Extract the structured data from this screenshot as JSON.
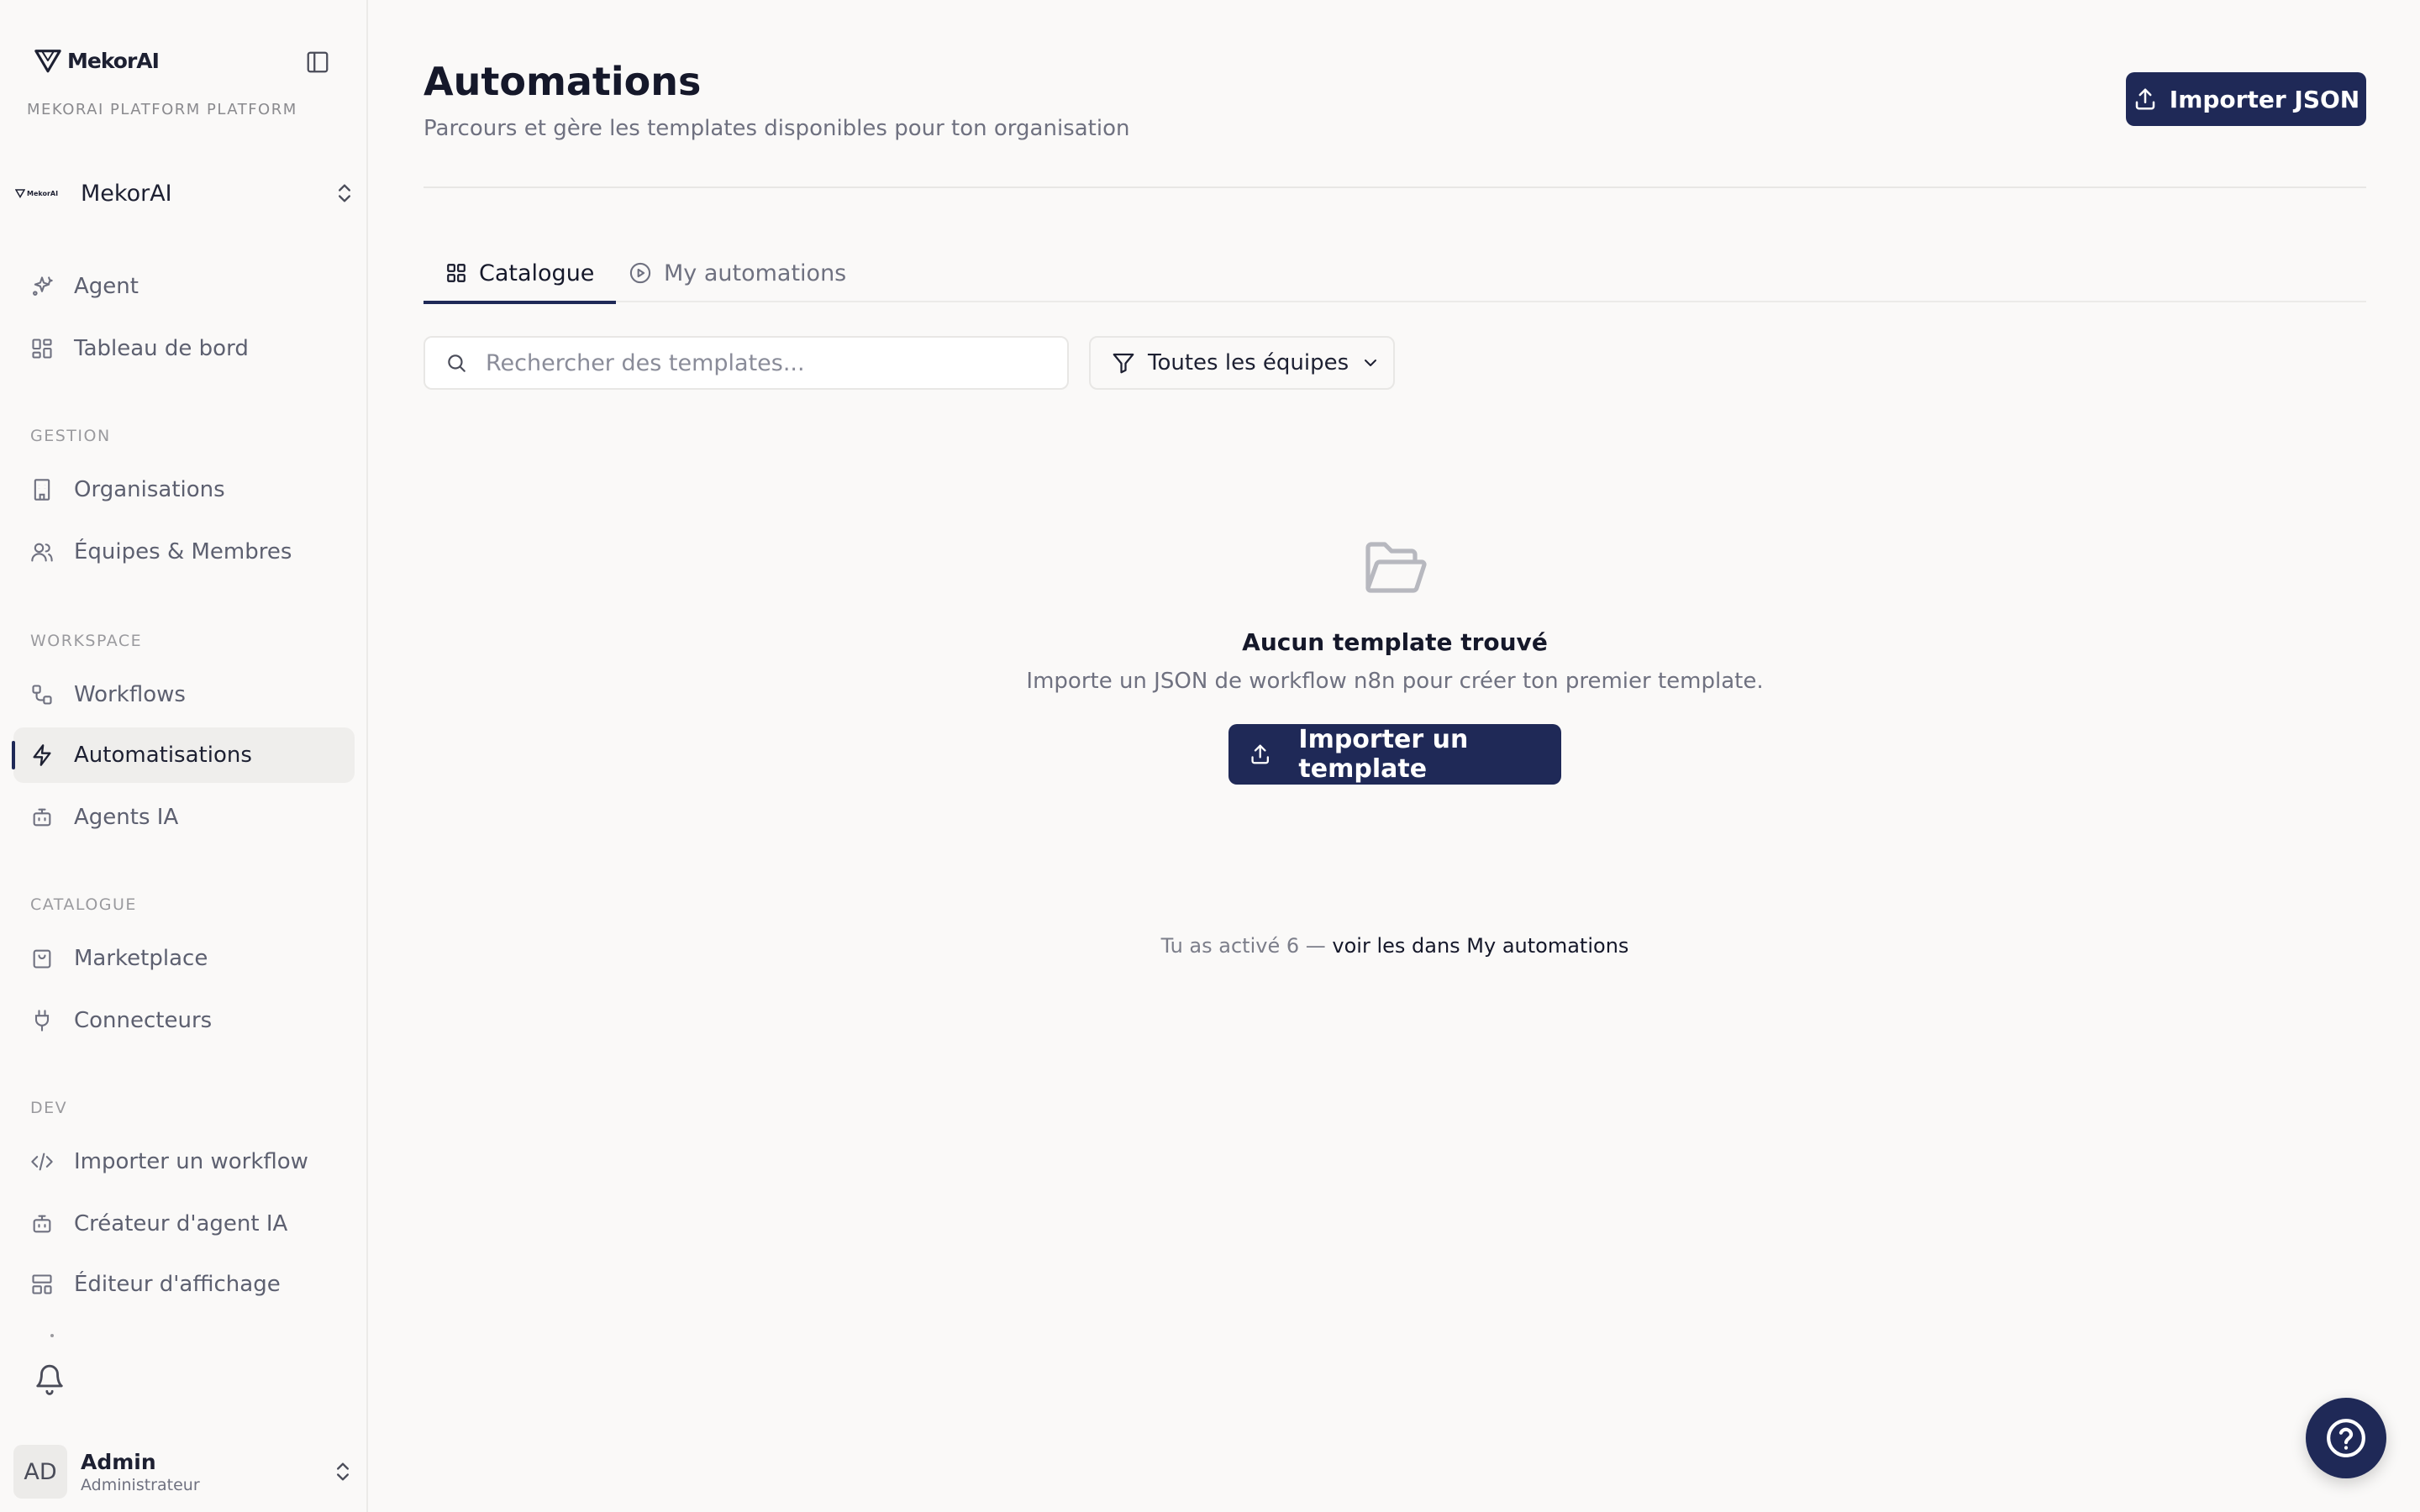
{
  "app": {
    "brand_name": "MekorAI",
    "platform_label": "MEKORAI PLATFORM PLATFORM"
  },
  "org": {
    "logo_text": "MekorAI",
    "name": "MekorAI"
  },
  "sidebar": {
    "top_items": [
      {
        "label": "Agent",
        "icon": "sparkles-icon"
      },
      {
        "label": "Tableau de bord",
        "icon": "dashboard-grid-icon"
      }
    ],
    "sections": [
      {
        "label": "GESTION",
        "items": [
          {
            "label": "Organisations",
            "icon": "building-icon"
          },
          {
            "label": "Équipes & Membres",
            "icon": "users-icon"
          }
        ]
      },
      {
        "label": "WORKSPACE",
        "items": [
          {
            "label": "Workflows",
            "icon": "workflow-icon"
          },
          {
            "label": "Automatisations",
            "icon": "lightning-icon",
            "active": true
          },
          {
            "label": "Agents IA",
            "icon": "bot-icon"
          }
        ]
      },
      {
        "label": "CATALOGUE",
        "items": [
          {
            "label": "Marketplace",
            "icon": "shopping-bag-icon"
          },
          {
            "label": "Connecteurs",
            "icon": "plug-icon"
          }
        ]
      },
      {
        "label": "DEV",
        "items": [
          {
            "label": "Importer un workflow",
            "icon": "code-icon"
          },
          {
            "label": "Créateur d'agent IA",
            "icon": "bot-icon"
          },
          {
            "label": "Éditeur d'affichage",
            "icon": "layout-icon"
          }
        ]
      }
    ]
  },
  "user": {
    "initials": "AD",
    "name": "Admin",
    "role": "Administrateur"
  },
  "page": {
    "title": "Automations",
    "subtitle": "Parcours et gère les templates disponibles pour ton organisation",
    "import_json_label": "Importer JSON"
  },
  "tabs": [
    {
      "label": "Catalogue",
      "active": true
    },
    {
      "label": "My automations",
      "active": false
    }
  ],
  "filters": {
    "search_placeholder": "Rechercher des templates...",
    "team_filter_label": "Toutes les équipes"
  },
  "empty_state": {
    "title": "Aucun template trouvé",
    "description": "Importe un JSON de workflow n8n pour créer ton premier template.",
    "button_label": "Importer un template"
  },
  "activation_note": {
    "prefix": "Tu as activé 6 — ",
    "link": "voir les dans My automations"
  },
  "colors": {
    "accent": "#1f2957",
    "background": "#faf9f8"
  }
}
